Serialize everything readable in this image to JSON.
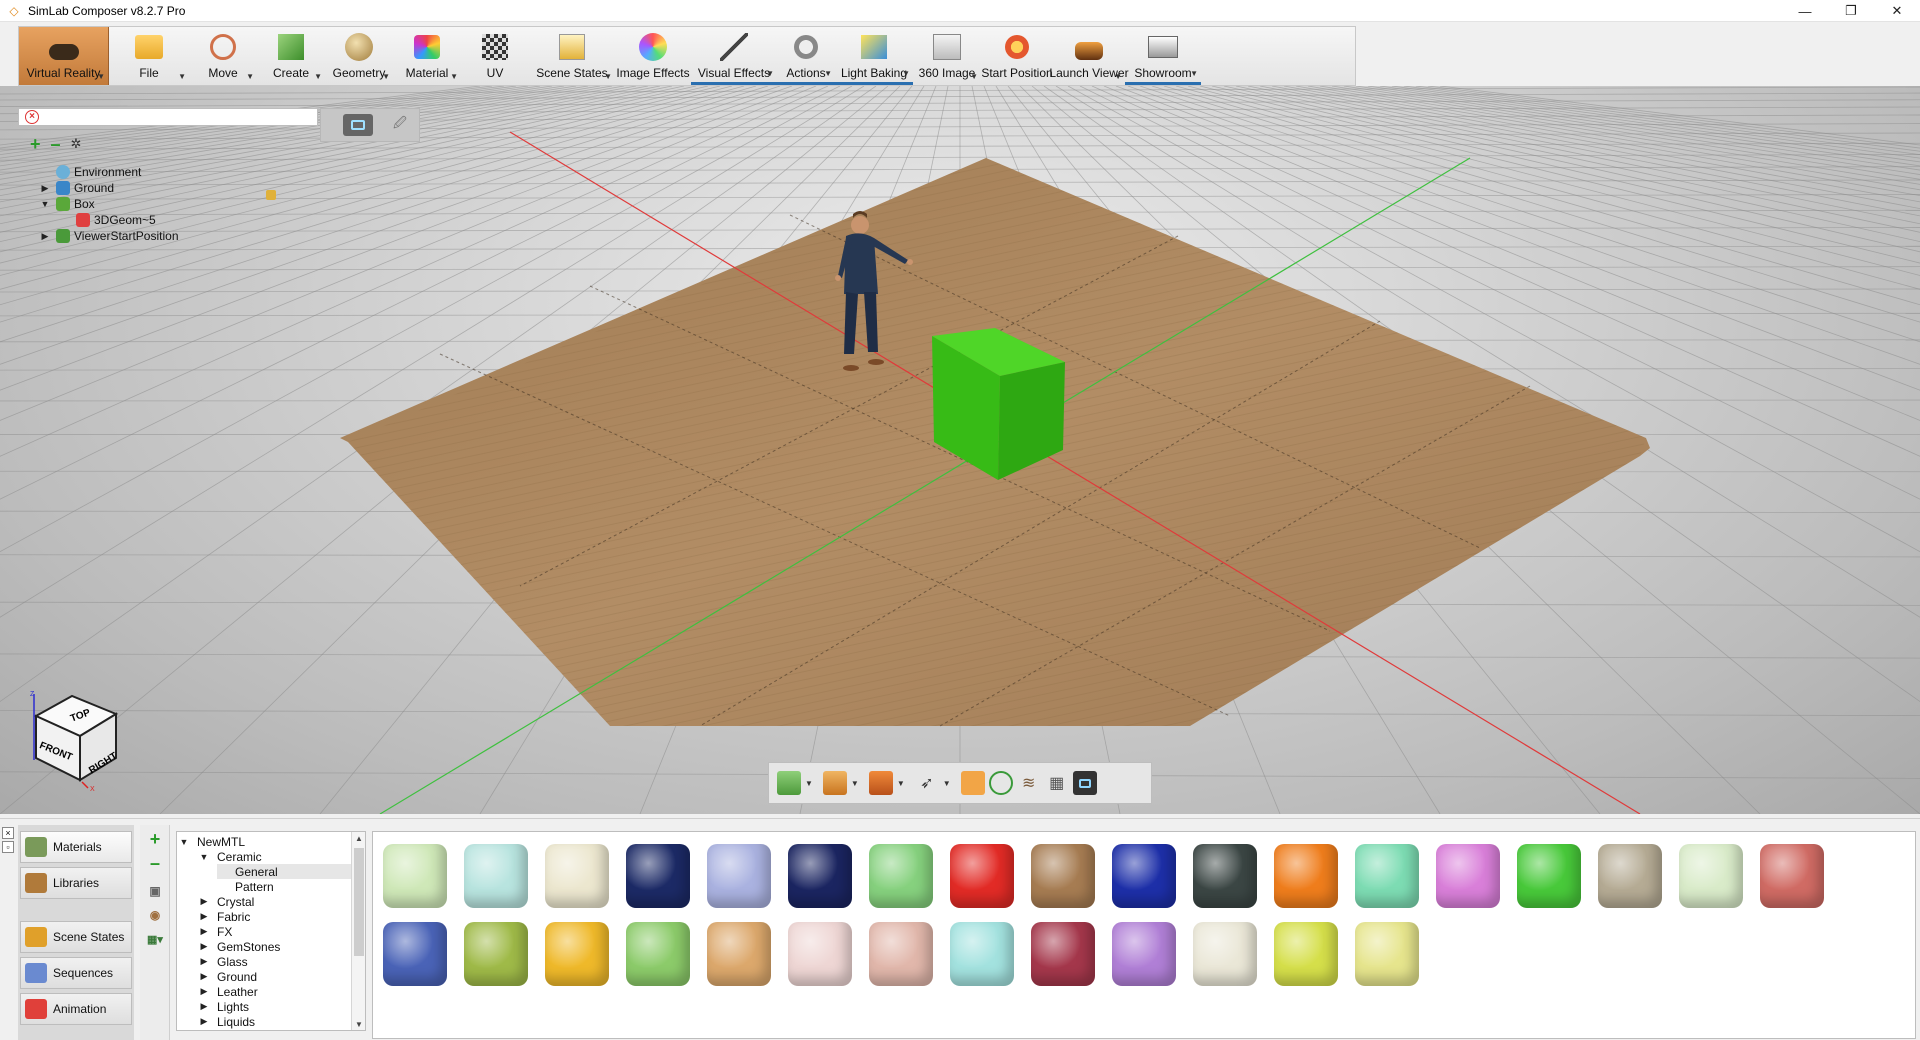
{
  "window": {
    "title": "SimLab Composer v8.2.7 Pro",
    "controls": {
      "minimize": "—",
      "restore": "❐",
      "close": "✕"
    }
  },
  "toolbar": {
    "items": [
      {
        "label": "Virtual Reality",
        "icon": "vr-headset-icon",
        "active": true,
        "dropdown": true
      },
      {
        "label": "File",
        "icon": "folder-icon",
        "dropdown": true
      },
      {
        "label": "Move",
        "icon": "move-gizmo-icon",
        "dropdown": true
      },
      {
        "label": "Create",
        "icon": "create-cube-icon",
        "dropdown": true
      },
      {
        "label": "Geometry",
        "icon": "geometry-sphere-icon",
        "dropdown": true
      },
      {
        "label": "Material",
        "icon": "material-palette-icon",
        "dropdown": true
      },
      {
        "label": "UV",
        "icon": "uv-checker-icon",
        "dropdown": false
      },
      {
        "label": "Scene States",
        "icon": "scene-states-icon",
        "dropdown": true
      },
      {
        "label": "Image Effects",
        "icon": "image-effects-icon",
        "dropdown": false
      },
      {
        "label": "Visual Effects",
        "icon": "visual-effects-wand-icon",
        "dropdown": true
      },
      {
        "label": "Actions",
        "icon": "actions-hand-icon",
        "dropdown": true
      },
      {
        "label": "Light Baking",
        "icon": "light-baking-icon",
        "dropdown": true
      },
      {
        "label": "360 Image",
        "icon": "360-image-icon",
        "dropdown": true
      },
      {
        "label": "Start Position",
        "icon": "start-position-pin-icon",
        "dropdown": false
      },
      {
        "label": "Launch Viewer",
        "icon": "launch-viewer-icon",
        "dropdown": true
      },
      {
        "label": "Showroom",
        "icon": "showroom-icon",
        "dropdown": true
      }
    ]
  },
  "scene_tree": {
    "search_placeholder": "",
    "nodes": [
      {
        "label": "Environment",
        "level": 0,
        "expand": ""
      },
      {
        "label": "Ground",
        "level": 1,
        "expand": "▶",
        "locked": true
      },
      {
        "label": "Box",
        "level": 1,
        "expand": "▼"
      },
      {
        "label": "3DGeom~5",
        "level": 2,
        "expand": ""
      },
      {
        "label": "ViewerStartPosition",
        "level": 1,
        "expand": "▶"
      }
    ]
  },
  "viewcube": {
    "top": "TOP",
    "front": "FRONT",
    "right": "RIGHT",
    "axis_z": "Z",
    "axis_x": "X"
  },
  "bottom_panel": {
    "side_tabs": [
      {
        "label": "Materials",
        "active": true
      },
      {
        "label": "Libraries"
      },
      {
        "label": "Scene States"
      },
      {
        "label": "Sequences"
      },
      {
        "label": "Animation"
      }
    ],
    "material_tree": [
      {
        "label": "NewMTL",
        "level": 0,
        "expand": "▼"
      },
      {
        "label": "Ceramic",
        "level": 1,
        "expand": "▼"
      },
      {
        "label": "General",
        "level": 2,
        "expand": "",
        "selected": true
      },
      {
        "label": "Pattern",
        "level": 2,
        "expand": ""
      },
      {
        "label": "Crystal",
        "level": 1,
        "expand": "▶"
      },
      {
        "label": "Fabric",
        "level": 1,
        "expand": "▶"
      },
      {
        "label": "FX",
        "level": 1,
        "expand": "▶"
      },
      {
        "label": "GemStones",
        "level": 1,
        "expand": "▶"
      },
      {
        "label": "Glass",
        "level": 1,
        "expand": "▶"
      },
      {
        "label": "Ground",
        "level": 1,
        "expand": "▶"
      },
      {
        "label": "Leather",
        "level": 1,
        "expand": "▶"
      },
      {
        "label": "Lights",
        "level": 1,
        "expand": "▶"
      },
      {
        "label": "Liquids",
        "level": 1,
        "expand": "▶"
      }
    ],
    "swatch_colors": [
      "#cfe8b8",
      "#b8e4df",
      "#ece7cf",
      "#1c2a66",
      "#aab2e0",
      "#1b2561",
      "#86d17e",
      "#e22b26",
      "#a67c52",
      "#1d2fa8",
      "#3b4644",
      "#ef7d1c",
      "#7ddcb3",
      "#d97fd9",
      "#48c93a",
      "#b5ab94",
      "#d9ebc9",
      "#d06b64",
      "#4a63b7",
      "#9fba48",
      "#efb92a",
      "#8ccb6a",
      "#dca86c",
      "#eed6d4",
      "#e1b7ab",
      "#a3e2df",
      "#a4374b",
      "#b07fd6",
      "#eae7d7",
      "#d5df4a",
      "#e6e58d"
    ]
  },
  "colors": {
    "active_tool": "#d08b4a",
    "floor": "#b08a62",
    "box": "#3cc21a",
    "grid_line": "#6a6a6a",
    "x_axis": "#e03a3a",
    "y_axis": "#3fc03f"
  }
}
